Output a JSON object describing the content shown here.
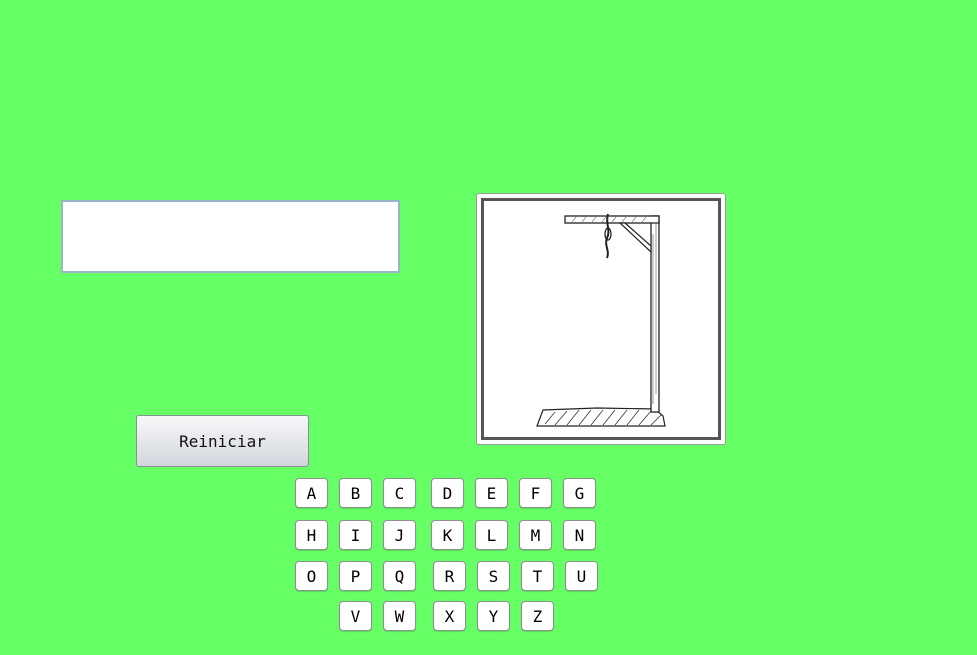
{
  "game": {
    "word_display": "",
    "reset_label": "Reiniciar",
    "gallows_image": "hangman-gallows-empty"
  },
  "keyboard": {
    "rows": [
      [
        "A",
        "B",
        "C",
        "D",
        "E",
        "F",
        "G"
      ],
      [
        "H",
        "I",
        "J",
        "K",
        "L",
        "M",
        "N"
      ],
      [
        "O",
        "P",
        "Q",
        "R",
        "S",
        "T",
        "U"
      ],
      [
        "V",
        "W",
        "X",
        "Y",
        "Z"
      ]
    ]
  },
  "colors": {
    "background": "#66ff66",
    "field_border": "#9ab4c8"
  }
}
